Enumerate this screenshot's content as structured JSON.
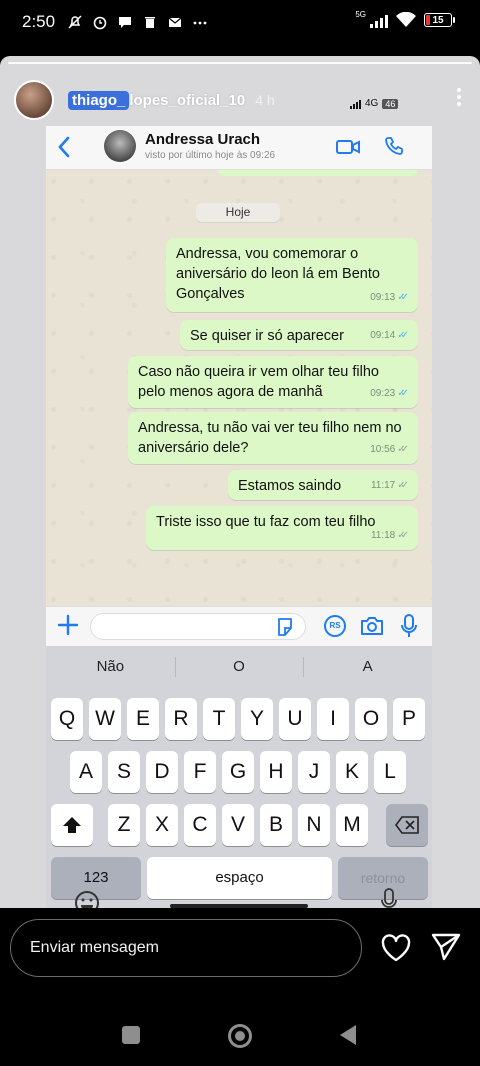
{
  "status_bar": {
    "time": "2:50",
    "network": "5G",
    "battery_level": "15",
    "battery_color": "#e53935"
  },
  "story": {
    "username_highlight": "thiago_",
    "username_rest": "lopes_oficial_10",
    "time_ago": "4 h",
    "inner_network": "4G",
    "inner_battery": "46",
    "reply_placeholder": "Enviar mensagem"
  },
  "whatsapp": {
    "contact_name": "Andressa Urach",
    "last_seen": "visto por último hoje às 09:26",
    "date_chip": "Hoje",
    "bubble_color": "#dcf8c6",
    "read_tick_color": "#4fb6ec",
    "messages": [
      {
        "text": "Andressa, vou comemorar o aniversário do leon lá em Bento Gonçalves",
        "time": "09:13",
        "ticks": "✓✓",
        "status": "read"
      },
      {
        "text": "Se quiser ir só aparecer",
        "time": "09:14",
        "ticks": "✓✓",
        "status": "read"
      },
      {
        "text": "Caso não queira ir vem olhar teu filho pelo menos agora de manhã",
        "time": "09:23",
        "ticks": "✓✓",
        "status": "read"
      },
      {
        "text": "Andressa, tu não vai ver teu filho nem no aniversário dele?",
        "time": "10:56",
        "ticks": "✓✓",
        "status": "delivered"
      },
      {
        "text": "Estamos saindo",
        "time": "11:17",
        "ticks": "✓✓",
        "status": "delivered"
      },
      {
        "text": "Triste isso que tu faz com teu filho",
        "time": "11:18",
        "ticks": "✓✓",
        "status": "delivered"
      }
    ],
    "rs_label": "RS"
  },
  "keyboard": {
    "suggestions": [
      "Não",
      "O",
      "A"
    ],
    "row1": [
      "Q",
      "W",
      "E",
      "R",
      "T",
      "Y",
      "U",
      "I",
      "O",
      "P"
    ],
    "row2": [
      "A",
      "S",
      "D",
      "F",
      "G",
      "H",
      "J",
      "K",
      "L"
    ],
    "row3": [
      "Z",
      "X",
      "C",
      "V",
      "B",
      "N",
      "M"
    ],
    "numbers_key": "123",
    "space_key": "espaço",
    "return_key": "retorno"
  }
}
